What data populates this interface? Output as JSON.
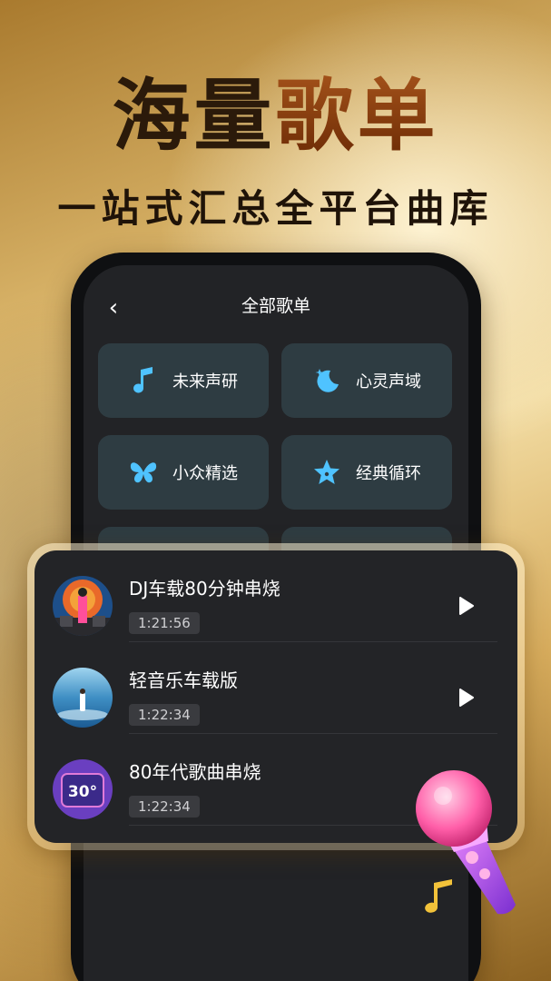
{
  "headline": {
    "part1": "海量",
    "part2": "歌单"
  },
  "subhead": "一站式汇总全平台曲库",
  "screen": {
    "back_glyph": "‹",
    "title": "全部歌单",
    "categories": [
      {
        "label": "未来声研",
        "icon": "music-note-icon"
      },
      {
        "label": "心灵声域",
        "icon": "moon-star-icon"
      },
      {
        "label": "小众精选",
        "icon": "butterfly-icon"
      },
      {
        "label": "经典循环",
        "icon": "star-icon"
      }
    ]
  },
  "playlist": [
    {
      "title": "DJ车载80分钟串烧",
      "duration": "1:21:56"
    },
    {
      "title": "轻音乐车载版",
      "duration": "1:22:34"
    },
    {
      "title": "80年代歌曲串烧",
      "duration": "1:22:34"
    }
  ],
  "cover3_text": "30°",
  "colors": {
    "accent_blue": "#4fc3ff",
    "tile_bg": "#2e3c42",
    "card_bg": "#232427"
  }
}
